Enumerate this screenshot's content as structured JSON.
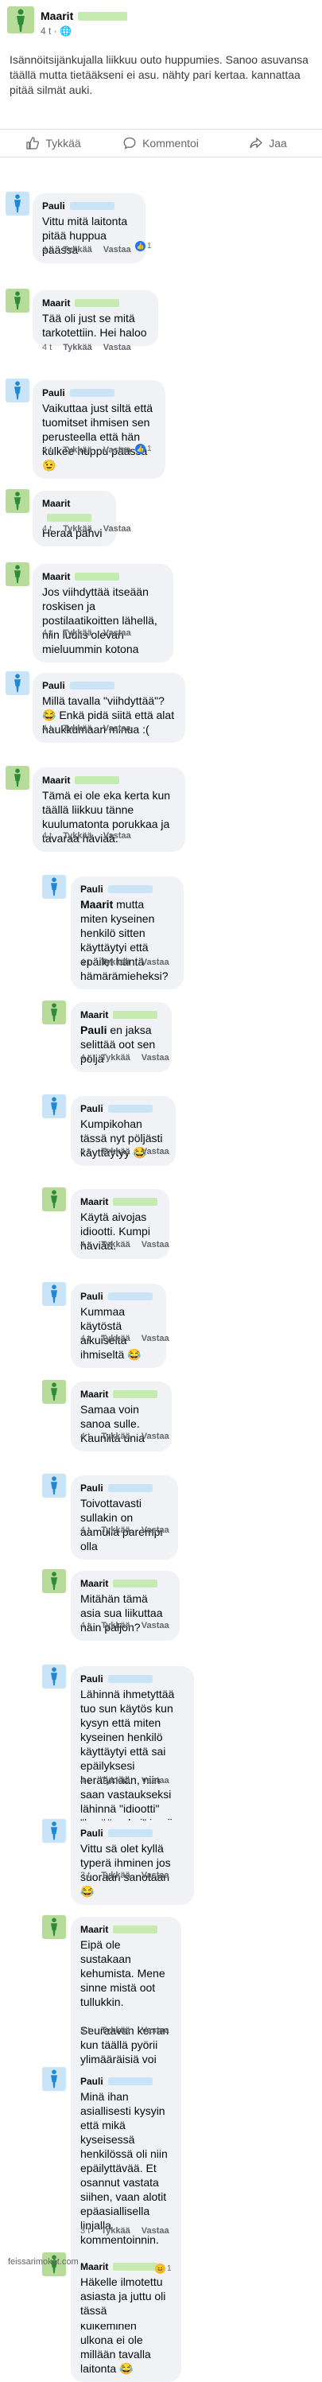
{
  "post": {
    "author": "Maarit",
    "meta": "4 t ·",
    "text": "Isännöitsijänkujalla liikkuu outo huppumies. Sanoo asuvansa täällä mutta tietääkseni ei asu. nähty pari kertaa. kannattaa pitää silmät auki.",
    "actions": {
      "like": "Tykkää",
      "comment": "Kommentoi",
      "share": "Jaa"
    }
  },
  "labels": {
    "like": "Tykkää",
    "reply": "Vastaa"
  },
  "comments": [
    {
      "author": "Pauli",
      "time": "4 t",
      "text": "Vittu mitä laitonta pitää huppua päässä",
      "reactions": "1"
    },
    {
      "author": "Maarit",
      "time": "4 t",
      "text": "Tää oli just se mitä tarkotettiin. Hei haloo"
    },
    {
      "author": "Pauli",
      "time": "4 t",
      "text": "Vaikuttaa just siltä että tuomitset ihmisen sen perusteella että hän kulkee huppu päässä 😉",
      "reactions": "1"
    },
    {
      "author": "Maarit",
      "time": "4 t",
      "text": "Heraa pahvi"
    },
    {
      "author": "Maarit",
      "time": "4 t",
      "text": "Jos viihdyttää itseään roskisen ja postilaatikoitten lähellä, niin luulis olevan mieluummin kotona"
    },
    {
      "author": "Pauli",
      "time": "4 t",
      "text": "Millä tavalla \"viihdyttää\"? 😂 Enkä pidä siitä että alat haukkumaan minua :("
    },
    {
      "author": "Maarit",
      "time": "4 t",
      "text": "Tämä ei ole eka kerta kun täällä liikkuu tänne kuulumatonta porukkaa ja tavaraa häviää."
    },
    {
      "author": "Pauli",
      "time": "4 t",
      "mention": "Maarit",
      "text": " mutta miten kyseinen henkilö sitten käyttäytyi että epäilet häntä hämärämieheksi?"
    },
    {
      "author": "Maarit",
      "time": "4 t",
      "mention": "Pauli",
      "text": " en jaksa selittää oot sen pöljä"
    },
    {
      "author": "Pauli",
      "time": "4 t",
      "text": "Kumpikohan tässä nyt pöljästi käyttäytyy 😂"
    },
    {
      "author": "Maarit",
      "time": "4 t",
      "text": "Käytä aivojas idiootti. Kumpi häviää."
    },
    {
      "author": "Pauli",
      "time": "4 t",
      "text": "Kummaa käytöstä aikuiselta ihmiseltä 😂"
    },
    {
      "author": "Maarit",
      "time": "4 t",
      "text": "Samaa voin sanoa sulle. Kauniita unia"
    },
    {
      "author": "Pauli",
      "time": "4 t",
      "text": "Toivottavasti sullakin on aamulla parempi olla"
    },
    {
      "author": "Maarit",
      "time": "4 t",
      "text": "Mitähän tämä asia sua liikuttaa näin paljon?"
    },
    {
      "author": "Pauli",
      "time": "4 t",
      "text": "Lähinnä ihmetyttää tuo sun käytös kun kysyn että miten kyseinen henkilö käyttäytyi että sai epäilyksesi heräämään, niin saan vastaukseksi lähinnä \"idiootti\" \"herää pahvi\" ja niin edespäin 😂"
    },
    {
      "author": "Pauli",
      "time": "3 t",
      "text": "Vittu sä olet kyllä typerä ihminen jos suoraan sanotaan 😂"
    },
    {
      "author": "Maarit",
      "time": "3 t",
      "text": "Eipä ole sustakaan kehumista. Mene sinne mistä oot tullukkin.\n\nSeuraavan kerran kun täällä pyörii ylimääräisiä voi tuntua persauksissa"
    },
    {
      "author": "Pauli",
      "time": "3 t",
      "text": "Minä ihan asiallisesti kysyin että mikä kyseisessä henkilössä oli niin epäilyttävää. Et osannut vastata siihen, vaan alotit epäasiallisella linjalla kommentoinnin.\n\nKannattaa myös yrittää sisäistää se että huppu päässä kulkeminen ulkona ei ole millään tavalla laitonta 😂"
    },
    {
      "author": "Maarit",
      "time": "3 t",
      "text": "Häkelle ilmotettu asiasta ja juttu oli tässä",
      "reactions": "1"
    }
  ],
  "watermark": "feissarimokat.com",
  "colors": {
    "green_avatar": "#b7dc9a",
    "blue_avatar": "#c9e4f7",
    "like_blue": "#1877f2",
    "haha_yellow": "#f7b928"
  }
}
